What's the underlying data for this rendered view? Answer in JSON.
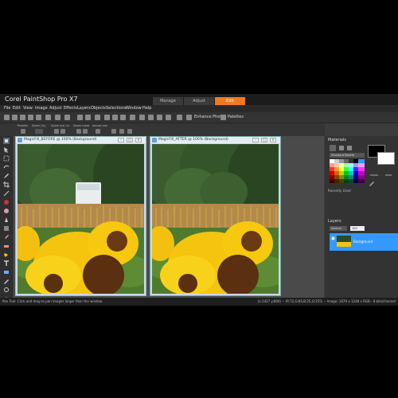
{
  "app": {
    "title": "Corel PaintShop Pro X7"
  },
  "mode_tabs": [
    {
      "label": "Manage"
    },
    {
      "label": "Adjust"
    },
    {
      "label": "Edit"
    }
  ],
  "menu": [
    "File",
    "Edit",
    "View",
    "Image",
    "Adjust",
    "Effects",
    "Layers",
    "Objects",
    "Selections",
    "Window",
    "Help"
  ],
  "toolbar": {
    "enhance_photo": "Enhance Photo",
    "palettes": "Palettes"
  },
  "options_bar": {
    "labels": [
      "Presets",
      "Zoom (%)",
      "Zoom out / in",
      "Zoom more",
      "Actual size"
    ]
  },
  "documents": [
    {
      "title": "MagicFill_BEFORE @ 100% (Background)"
    },
    {
      "title": "MagicFill_AFTER @ 100% (Background)"
    }
  ],
  "materials": {
    "title": "Materials",
    "palette_select": "Standard Palette",
    "recently_used": "Recently Used"
  },
  "layers": {
    "title": "Layers",
    "blend_mode": "Normal",
    "opacity": "100",
    "layer_name": "Background"
  },
  "status": {
    "left": "Pan Tool: Click and drag to pan images larger than the window.",
    "right": "(x:1427 y:804) -- (R:72,G:85,B:25,O:255) -- Image: 1679 x 1248 x RGB - 8 bits/channel"
  },
  "colors": {
    "accent": "#f07a20",
    "layer_selected": "#3399ff",
    "app_bg": "#3c3c3c"
  }
}
